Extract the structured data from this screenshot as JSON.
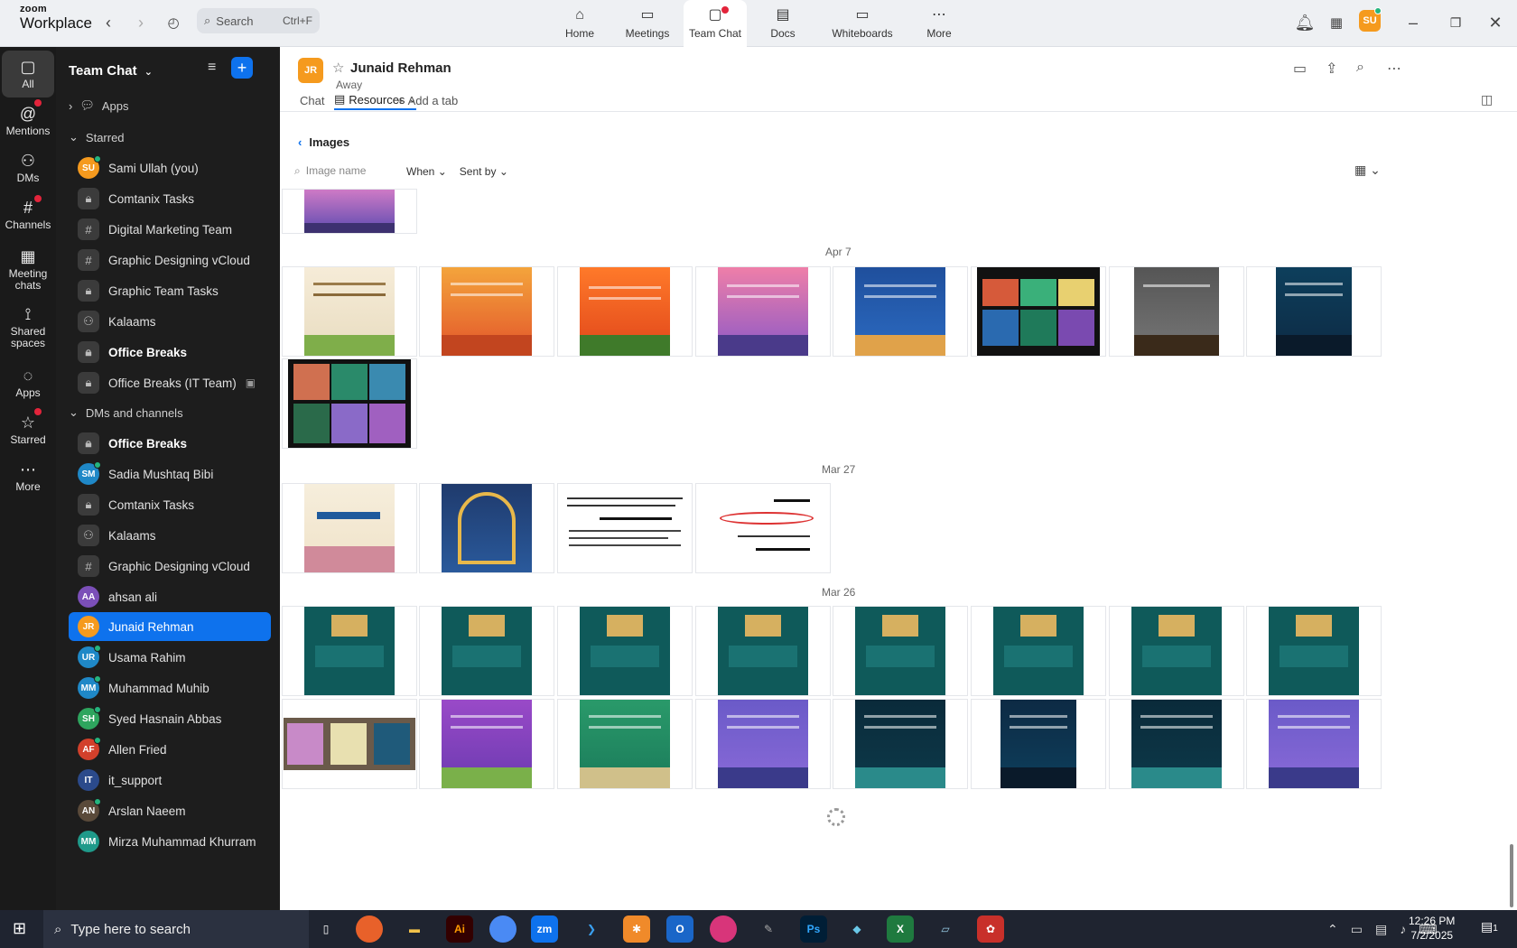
{
  "app": {
    "logo_line1": "zoom",
    "logo_line2": "Workplace",
    "search_placeholder": "Search",
    "search_shortcut": "Ctrl+F",
    "avatar_initials": "SU"
  },
  "nav_tabs": [
    {
      "label": "Home",
      "icon": "home-icon"
    },
    {
      "label": "Meetings",
      "icon": "video-icon"
    },
    {
      "label": "Team Chat",
      "icon": "chat-icon"
    },
    {
      "label": "Docs",
      "icon": "doc-icon"
    },
    {
      "label": "Whiteboards",
      "icon": "whiteboard-icon"
    },
    {
      "label": "More",
      "icon": "ellipsis-icon"
    }
  ],
  "rail": [
    {
      "label": "All",
      "icon": "chat-bubble-icon"
    },
    {
      "label": "Mentions",
      "icon": "at-icon"
    },
    {
      "label": "DMs",
      "icon": "people-icon"
    },
    {
      "label": "Channels",
      "icon": "hash-icon"
    },
    {
      "label": "Meeting chats",
      "icon": "calendar-icon"
    },
    {
      "label": "Shared spaces",
      "icon": "share-icon"
    },
    {
      "label": "Apps",
      "icon": "apps-icon"
    },
    {
      "label": "Starred",
      "icon": "star-icon"
    },
    {
      "label": "More",
      "icon": "ellipsis-icon"
    }
  ],
  "sidebar": {
    "title": "Team Chat",
    "apps_label": "Apps",
    "starred_label": "Starred",
    "dms_label": "DMs and channels",
    "starred_items": [
      {
        "label": "Sami Ullah (you)",
        "kind": "avatar",
        "initials": "SU",
        "color": "#f59a1e"
      },
      {
        "label": "Comtanix Tasks",
        "kind": "lock"
      },
      {
        "label": "Digital Marketing Team",
        "kind": "hash"
      },
      {
        "label": "Graphic Designing vCloud",
        "kind": "hash"
      },
      {
        "label": "Graphic Team Tasks",
        "kind": "lock"
      },
      {
        "label": "Kalaams",
        "kind": "group"
      },
      {
        "label": "Office Breaks",
        "kind": "lock",
        "bold": true
      },
      {
        "label": "Office Breaks (IT Team)",
        "kind": "lock"
      }
    ],
    "dm_items": [
      {
        "label": "Office Breaks",
        "kind": "lock",
        "bold": true
      },
      {
        "label": "Sadia Mushtaq Bibi",
        "kind": "avatar",
        "initials": "SM",
        "color": "#1f88c7"
      },
      {
        "label": "Comtanix Tasks",
        "kind": "lock"
      },
      {
        "label": "Kalaams",
        "kind": "group"
      },
      {
        "label": "Graphic Designing vCloud",
        "kind": "hash"
      },
      {
        "label": "ahsan ali",
        "kind": "avatar",
        "initials": "AA",
        "color": "#7b4fb8"
      },
      {
        "label": "Junaid Rehman",
        "kind": "avatar",
        "initials": "JR",
        "color": "#f59a1e",
        "selected": true
      },
      {
        "label": "Usama Rahim",
        "kind": "avatar",
        "initials": "UR",
        "color": "#1f88c7"
      },
      {
        "label": "Muhammad Muhib",
        "kind": "avatar",
        "initials": "MM",
        "color": "#1f88c7"
      },
      {
        "label": "Syed Hasnain Abbas",
        "kind": "avatar",
        "initials": "SH",
        "color": "#2ea55e"
      },
      {
        "label": "Allen Fried",
        "kind": "avatar",
        "initials": "AF",
        "color": "#d2402b"
      },
      {
        "label": "it_support",
        "kind": "avatar",
        "initials": "IT",
        "color": "#2b4a8b"
      },
      {
        "label": "Arslan Naeem",
        "kind": "avatar",
        "initials": "AN",
        "color": "#5a4a3a"
      },
      {
        "label": "Mirza Muhammad Khurram",
        "kind": "avatar",
        "initials": "MM",
        "color": "#1f9a8a"
      }
    ]
  },
  "conversation": {
    "initials": "JR",
    "name": "Junaid Rehman",
    "status": "Away",
    "tab_chat": "Chat",
    "tab_resources": "Resources",
    "tab_add": "Add a tab"
  },
  "resources": {
    "breadcrumb": "Images",
    "search_placeholder": "Image name",
    "filter_when": "When",
    "filter_sent_by": "Sent by",
    "groups": [
      {
        "date": "",
        "count": 1
      },
      {
        "date": "Apr 7",
        "count": 9
      },
      {
        "date": "Mar 27",
        "count": 4
      },
      {
        "date": "Mar 26",
        "count": 16
      }
    ]
  },
  "colors": {
    "accent": "#0e72ed",
    "zoom_orange": "#f59a1e",
    "sidebar_bg": "#1d1d1d",
    "rail_bg": "#1a1a1a"
  },
  "taskbar": {
    "search_placeholder": "Type here to search",
    "time": "12:26 PM",
    "date": "7/2/2025",
    "notification_count": "1"
  }
}
